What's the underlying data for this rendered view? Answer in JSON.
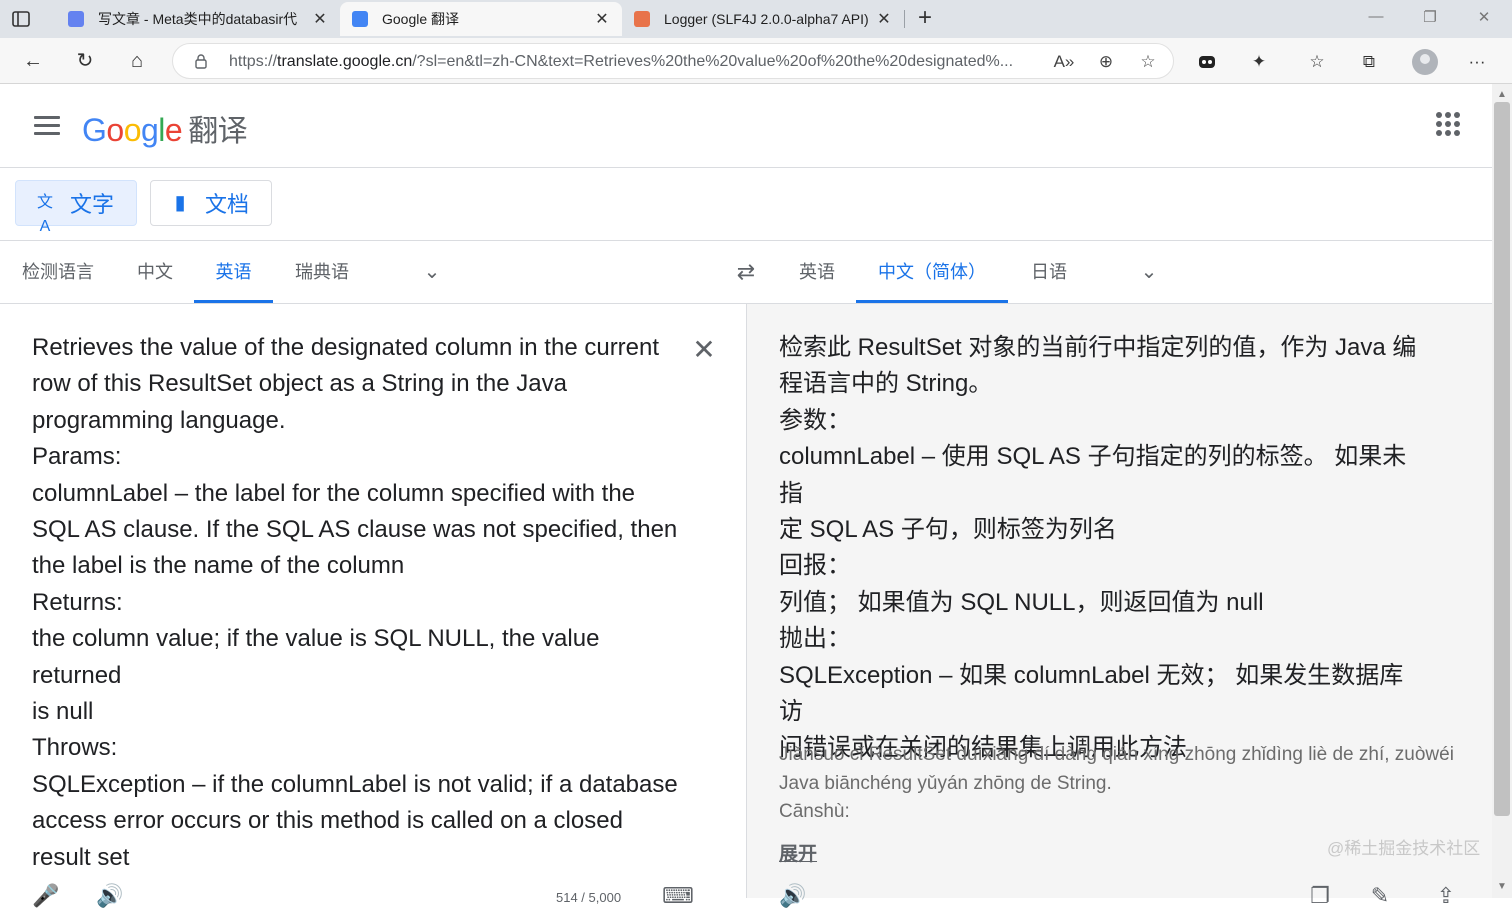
{
  "browser": {
    "tabs": [
      {
        "title": "写文章 - Meta类中的databasir代",
        "close": "✕",
        "favicon_color": "#6482f0"
      },
      {
        "title": "Google 翻译",
        "close": "✕",
        "favicon_color": "#4285f4"
      },
      {
        "title": "Logger (SLF4J 2.0.0-alpha7 API)",
        "close": "✕",
        "favicon_color": "#e8734a"
      }
    ],
    "new_tab": "+",
    "window_controls": {
      "minimize": "—",
      "restore": "❐",
      "close": "✕"
    },
    "address": {
      "prefix": "https://",
      "host": "translate.google.cn",
      "path": "/?sl=en&tl=zh-CN&text=Retrieves%20the%20value%20of%20the%20designated%..."
    },
    "icons": {
      "back": "←",
      "refresh": "↻",
      "home": "⌂",
      "read_aloud": "A»",
      "zoom": "⊕",
      "favorite_add": "☆",
      "extension": "✦",
      "favorites": "☆",
      "collections": "⧉",
      "more": "···"
    }
  },
  "header": {
    "logo_letters": [
      "G",
      "o",
      "o",
      "g",
      "l",
      "e"
    ],
    "product_name": "翻译"
  },
  "modes": {
    "text": "文字",
    "documents": "文档",
    "text_icon": "文A",
    "doc_icon": "▮"
  },
  "source_langs": [
    "检测语言",
    "中文",
    "英语",
    "瑞典语"
  ],
  "source_selected": "英语",
  "target_langs": [
    "英语",
    "中文（简体）",
    "日语"
  ],
  "target_selected": "中文（简体）",
  "swap_icon": "⇄",
  "chevron": "⌄",
  "source_text": "Retrieves the value of the designated column in the current\nrow of this ResultSet object as a String in the Java\nprogramming language.\nParams:\ncolumnLabel – the label for the column specified with the\nSQL AS clause. If the SQL AS clause was not specified, then\nthe label is the name of the column\nReturns:\nthe column value; if the value is SQL NULL, the value returned\nis null\nThrows:\nSQLException – if the columnLabel is not valid; if a database\naccess error occurs or this method is called on a closed\nresult set",
  "clear_icon": "✕",
  "translation_text": "检索此 ResultSet 对象的当前行中指定列的值，作为 Java 编\n程语言中的 String。\n参数：\ncolumnLabel – 使用 SQL AS 子句指定的列的标签。 如果未指\n定 SQL AS 子句，则标签为列名\n回报：\n列值； 如果值为 SQL NULL，则返回值为 null\n抛出：\nSQLException – 如果 columnLabel 无效； 如果发生数据库访\n问错误或在关闭的结果集上调用此方法",
  "transliteration": "Jiǎnsuǒ cǐ ResultSet duìxiàng dí dàng qián xíng zhōng zhǐdìng liè de zhí, zuòwéi\nJava biānchéng yǔyán zhōng de String.\nCānshù:",
  "expand_label": "展开",
  "char_count": "514 / 5,000",
  "watermark": "@稀土掘金技术社区",
  "bottom_icons": {
    "mic": "🎤",
    "speaker": "🔊",
    "keyboard": "⌨",
    "copy": "❐",
    "feedback": "✎",
    "share": "⇪"
  },
  "scroll_arrows": {
    "up": "▲",
    "down": "▼"
  }
}
